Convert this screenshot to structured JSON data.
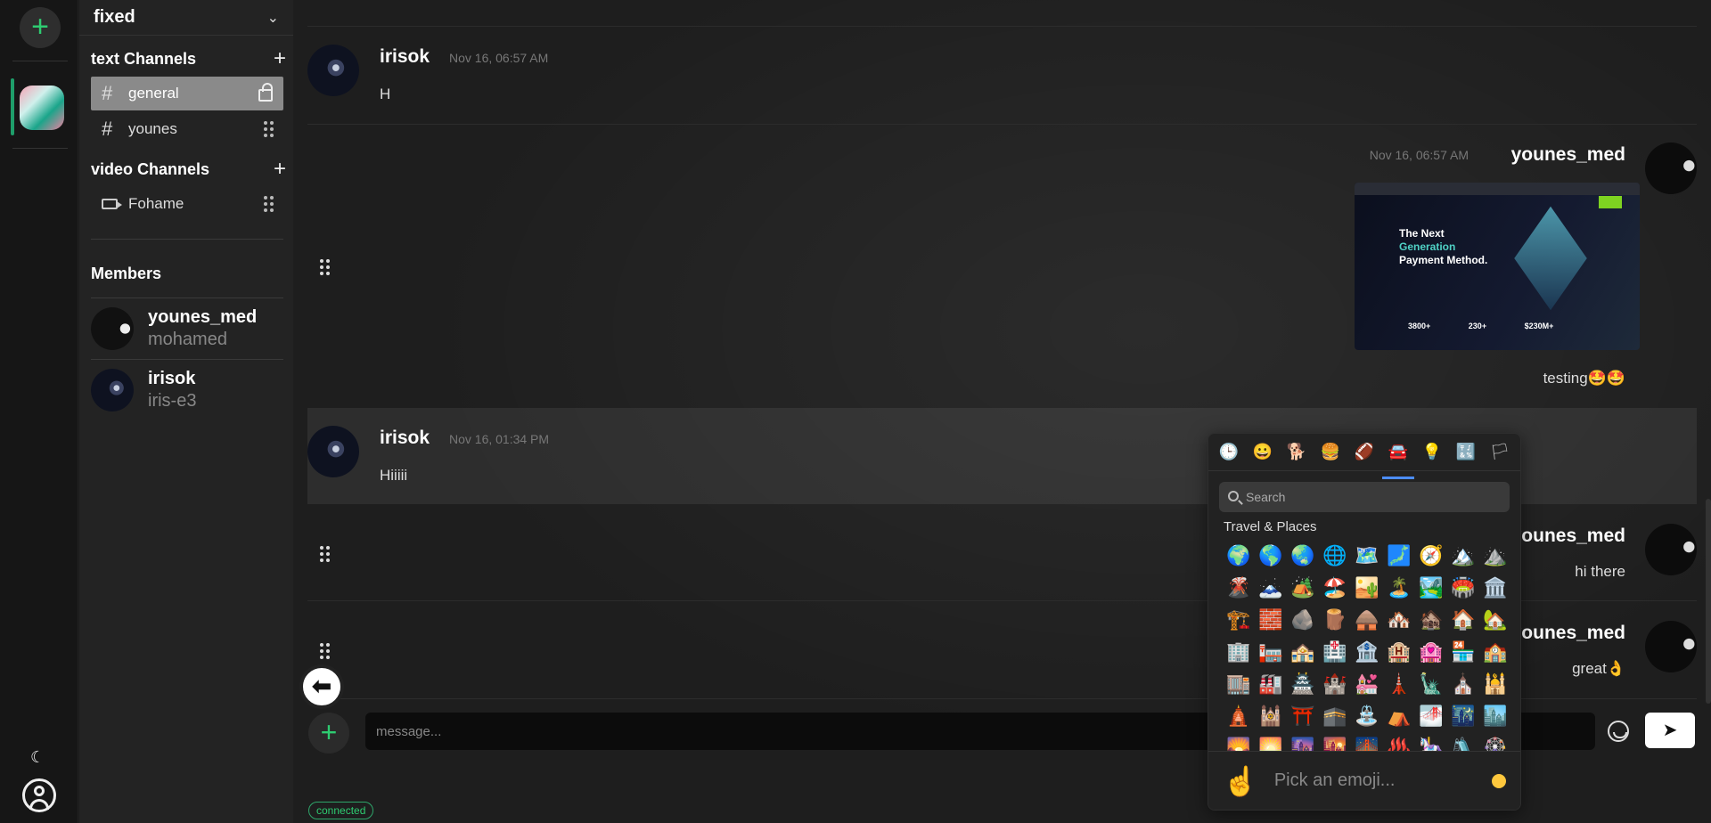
{
  "rail": {
    "add_label": "+",
    "moon": "☾",
    "icons": [
      "plus-icon",
      "moon-icon",
      "user-icon"
    ]
  },
  "server": {
    "name": "fixed"
  },
  "channels": {
    "text_title": "text Channels",
    "text": [
      {
        "label": "general",
        "active": true,
        "icon": "lock-icon"
      },
      {
        "label": "younes",
        "active": false,
        "icon": "drag-handle-icon"
      }
    ],
    "video_title": "video Channels",
    "video": [
      {
        "label": "Fohame",
        "icon": "drag-handle-icon"
      }
    ]
  },
  "members": {
    "title": "Members",
    "list": [
      {
        "username": "younes_med",
        "display": "mohamed"
      },
      {
        "username": "irisok",
        "display": "iris-e3"
      }
    ]
  },
  "messages": [
    {
      "author": "irisok",
      "time": "Nov 16, 06:57 AM",
      "text": "H",
      "side": "left"
    },
    {
      "author": "younes_med",
      "time": "Nov 16, 06:57 AM",
      "text": "testing🤩🤩",
      "side": "right",
      "image": {
        "headline_a": "The Next",
        "headline_b": "Generation",
        "headline_c": "Payment Method.",
        "stat_a": "3800+",
        "stat_b": "230+",
        "stat_c": "$230M+"
      }
    },
    {
      "author": "irisok",
      "time": "Nov 16, 01:34 PM",
      "text": "Hiiiii",
      "side": "left",
      "highlighted": true
    },
    {
      "author": "younes_med",
      "time": "",
      "text": "hi there",
      "side": "right"
    },
    {
      "author": "younes_med",
      "time": "",
      "text": "great👌",
      "side": "right"
    }
  ],
  "composer": {
    "placeholder": "message...",
    "send_icon": "➤",
    "back_icon": "⬅"
  },
  "status": "connected",
  "emoji_picker": {
    "categories": [
      "🕒",
      "😀",
      "🐕",
      "🍔",
      "🏈",
      "🚘",
      "💡",
      "🔣",
      "🏳"
    ],
    "selected_category": 5,
    "search_placeholder": "Search",
    "section_title": "Travel & Places",
    "emojis": [
      "🌍",
      "🌎",
      "🌏",
      "🌐",
      "🗺️",
      "🗾",
      "🧭",
      "🏔️",
      "⛰️",
      "🌋",
      "🗻",
      "🏕️",
      "🏖️",
      "🏜️",
      "🏝️",
      "🏞️",
      "🏟️",
      "🏛️",
      "🏗️",
      "🧱",
      "🪨",
      "🪵",
      "🛖",
      "🏘️",
      "🏚️",
      "🏠",
      "🏡",
      "🏢",
      "🏣",
      "🏤",
      "🏥",
      "🏦",
      "🏨",
      "🏩",
      "🏪",
      "🏫",
      "🏬",
      "🏭",
      "🏯",
      "🏰",
      "💒",
      "🗼",
      "🗽",
      "⛪",
      "🕌",
      "🛕",
      "🕍",
      "⛩️",
      "🕋",
      "⛲",
      "⛺",
      "🌁",
      "🌃",
      "🏙️",
      "🌄",
      "🌅",
      "🌆",
      "🌇",
      "🌉",
      "♨️",
      "🎠",
      "🛝",
      "🎡"
    ],
    "footer_emoji": "☝️",
    "footer_hint": "Pick an emoji...",
    "skin_tone_color": "#ffc83d"
  },
  "colors": {
    "accent": "#2ecc71",
    "picker_selected": "#4c8dff"
  }
}
